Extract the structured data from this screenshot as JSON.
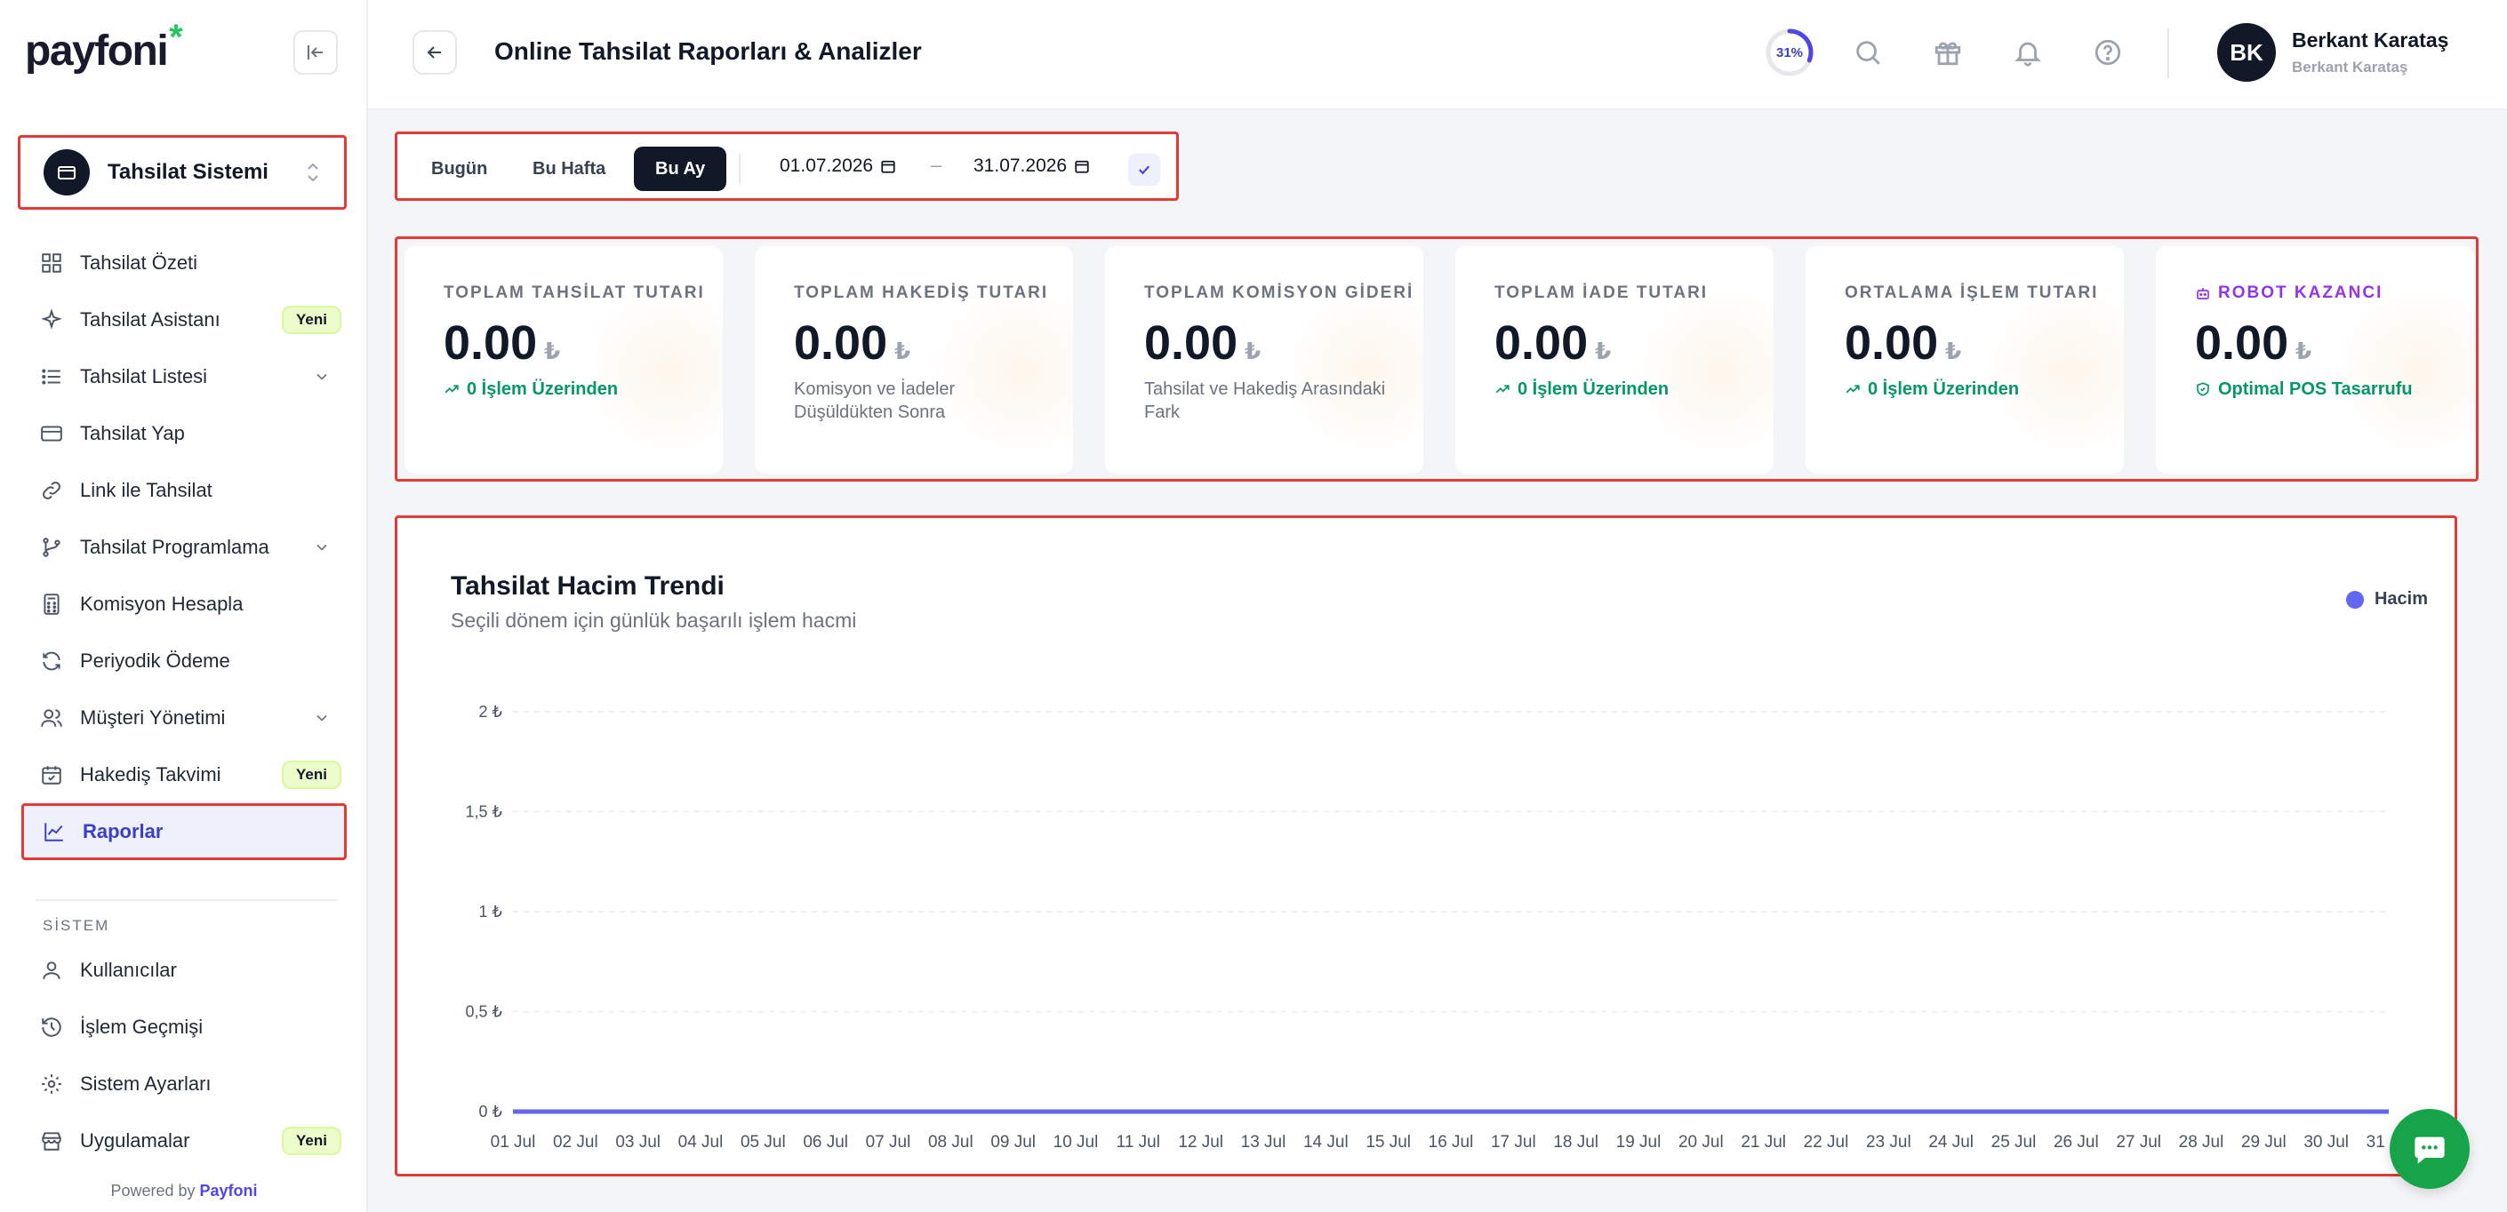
{
  "brand": {
    "logo_text": "payfoni",
    "logo_mark": "*",
    "powered_prefix": "Powered by",
    "powered_brand": "Payfoni",
    "accent": "#22c55e"
  },
  "sidebar": {
    "system_selector": "Tahsilat Sistemi",
    "items": [
      {
        "label": "Tahsilat Özeti",
        "icon": "dashboard-grid-icon"
      },
      {
        "label": "Tahsilat Asistanı",
        "icon": "sparkles-icon",
        "badge": "Yeni"
      },
      {
        "label": "Tahsilat Listesi",
        "icon": "list-icon",
        "chevron": true
      },
      {
        "label": "Tahsilat Yap",
        "icon": "credit-card-icon"
      },
      {
        "label": "Link ile Tahsilat",
        "icon": "link-icon"
      },
      {
        "label": "Tahsilat Programlama",
        "icon": "git-branch-icon",
        "chevron": true
      },
      {
        "label": "Komisyon Hesapla",
        "icon": "calculator-icon"
      },
      {
        "label": "Periyodik Ödeme",
        "icon": "refresh-icon"
      },
      {
        "label": "Müşteri Yönetimi",
        "icon": "users-icon",
        "chevron": true
      },
      {
        "label": "Hakediş Takvimi",
        "icon": "calendar-check-icon",
        "badge": "Yeni"
      },
      {
        "label": "Raporlar",
        "icon": "chart-line-icon",
        "active": true
      }
    ],
    "section_label": "SİSTEM",
    "system_items": [
      {
        "label": "Kullanıcılar",
        "icon": "user-icon"
      },
      {
        "label": "İşlem Geçmişi",
        "icon": "history-icon"
      },
      {
        "label": "Sistem Ayarları",
        "icon": "gear-icon"
      },
      {
        "label": "Uygulamalar",
        "icon": "store-icon",
        "badge": "Yeni"
      }
    ]
  },
  "header": {
    "title": "Online Tahsilat Raporları & Analizler",
    "progress_label": "31%",
    "progress": 0.31,
    "user_initials": "BK",
    "user_name": "Berkant Karataş",
    "user_subtitle": "Berkant Karataş"
  },
  "filter": {
    "segments": [
      "Bugün",
      "Bu Hafta",
      "Bu Ay"
    ],
    "selected": "Bu Ay",
    "date_from": "01.07.2026",
    "date_to": "31.07.2026",
    "separator": "–"
  },
  "kpis": [
    {
      "title": "TOPLAM TAHSİLAT TUTARI",
      "value": "0.00",
      "currency": "₺",
      "sub": "0 İşlem Üzerinden",
      "sub_style": "green"
    },
    {
      "title": "TOPLAM HAKEDİŞ TUTARI",
      "value": "0.00",
      "currency": "₺",
      "sub": "Komisyon ve İadeler Düşüldükten Sonra",
      "sub_style": "muted"
    },
    {
      "title": "TOPLAM KOMİSYON GİDERİ",
      "value": "0.00",
      "currency": "₺",
      "sub": "Tahsilat ve Hakediş Arasındaki Fark",
      "sub_style": "muted"
    },
    {
      "title": "TOPLAM İADE TUTARI",
      "value": "0.00",
      "currency": "₺",
      "sub": "0 İşlem Üzerinden",
      "sub_style": "green"
    },
    {
      "title": "ORTALAMA İŞLEM TUTARI",
      "value": "0.00",
      "currency": "₺",
      "sub": "0 İşlem Üzerinden",
      "sub_style": "green"
    },
    {
      "title": "ROBOT KAZANCI",
      "value": "0.00",
      "currency": "₺",
      "sub": "Optimal POS Tasarrufu",
      "sub_style": "green-shield"
    }
  ],
  "chart": {
    "title": "Tahsilat Hacim Trendi",
    "subtitle": "Seçili dönem için günlük başarılı işlem hacmi",
    "legend": "Hacim",
    "color": "#6366f1"
  },
  "chart_data": {
    "type": "line",
    "title": "Tahsilat Hacim Trendi",
    "x": [
      "01 Jul",
      "02 Jul",
      "03 Jul",
      "04 Jul",
      "05 Jul",
      "06 Jul",
      "07 Jul",
      "08 Jul",
      "09 Jul",
      "10 Jul",
      "11 Jul",
      "12 Jul",
      "13 Jul",
      "14 Jul",
      "15 Jul",
      "16 Jul",
      "17 Jul",
      "18 Jul",
      "19 Jul",
      "20 Jul",
      "21 Jul",
      "22 Jul",
      "23 Jul",
      "24 Jul",
      "25 Jul",
      "26 Jul",
      "27 Jul",
      "28 Jul",
      "29 Jul",
      "30 Jul",
      "31 Jul"
    ],
    "series": [
      {
        "name": "Hacim",
        "values": [
          0,
          0,
          0,
          0,
          0,
          0,
          0,
          0,
          0,
          0,
          0,
          0,
          0,
          0,
          0,
          0,
          0,
          0,
          0,
          0,
          0,
          0,
          0,
          0,
          0,
          0,
          0,
          0,
          0,
          0,
          0
        ]
      }
    ],
    "y_ticks": [
      "0 ₺",
      "0,5 ₺",
      "1 ₺",
      "1,5 ₺",
      "2 ₺"
    ],
    "ylim": [
      0,
      2
    ],
    "grid": true,
    "legend_position": "top-right"
  }
}
